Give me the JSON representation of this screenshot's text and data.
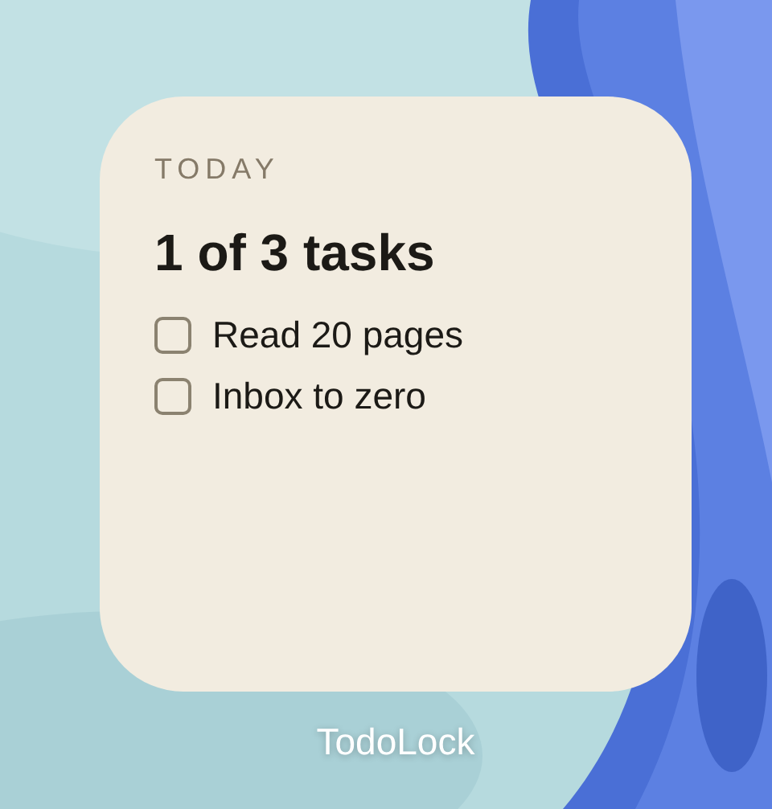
{
  "widget": {
    "label": "TODAY",
    "summary": "1 of 3 tasks",
    "tasks": [
      {
        "text": "Read 20 pages",
        "checked": false
      },
      {
        "text": "Inbox to zero",
        "checked": false
      }
    ]
  },
  "app_name": "TodoLock"
}
